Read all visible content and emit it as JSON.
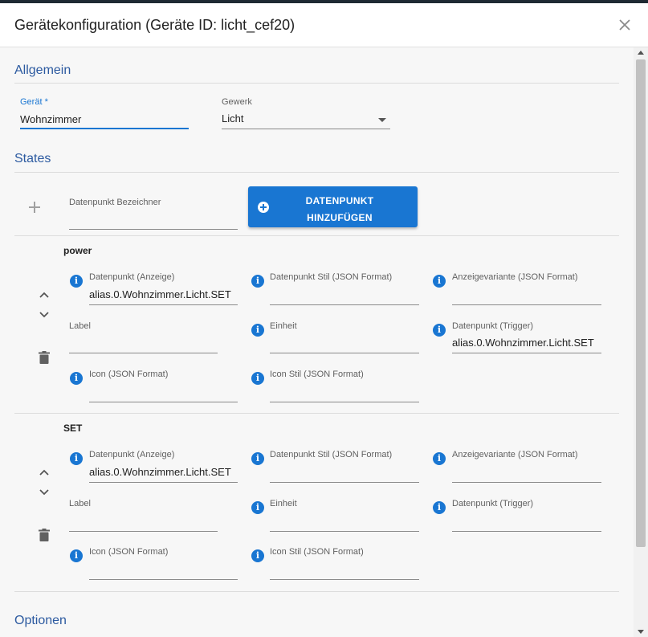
{
  "dialog": {
    "title": "Gerätekonfiguration (Geräte ID: licht_cef20)"
  },
  "sections": {
    "general": "Allgemein",
    "states": "States",
    "options": "Optionen"
  },
  "general": {
    "device_label": "Gerät *",
    "device_value": "Wohnzimmer",
    "trade_label": "Gewerk",
    "trade_value": "Licht"
  },
  "add_datapoint": {
    "label": "Datenpunkt Bezeichner",
    "value": "",
    "button_line1": "DATENPUNKT",
    "button_line2": "HINZUFÜGEN"
  },
  "states": [
    {
      "name": "power",
      "fields": {
        "dp_display_label": "Datenpunkt (Anzeige)",
        "dp_display_value": "alias.0.Wohnzimmer.Licht.SET",
        "dp_style_label": "Datenpunkt Stil (JSON Format)",
        "dp_style_value": "",
        "variant_label": "Anzeigevariante (JSON Format)",
        "variant_value": "",
        "label_label": "Label",
        "label_value": "",
        "unit_label": "Einheit",
        "unit_value": "",
        "trigger_label": "Datenpunkt (Trigger)",
        "trigger_value": "alias.0.Wohnzimmer.Licht.SET",
        "icon_label": "Icon (JSON Format)",
        "icon_value": "",
        "icon_style_label": "Icon Stil (JSON Format)",
        "icon_style_value": ""
      }
    },
    {
      "name": "SET",
      "fields": {
        "dp_display_label": "Datenpunkt (Anzeige)",
        "dp_display_value": "alias.0.Wohnzimmer.Licht.SET",
        "dp_style_label": "Datenpunkt Stil (JSON Format)",
        "dp_style_value": "",
        "variant_label": "Anzeigevariante (JSON Format)",
        "variant_value": "",
        "label_label": "Label",
        "label_value": "",
        "unit_label": "Einheit",
        "unit_value": "",
        "trigger_label": "Datenpunkt (Trigger)",
        "trigger_value": "",
        "icon_label": "Icon (JSON Format)",
        "icon_value": "",
        "icon_style_label": "Icon Stil (JSON Format)",
        "icon_style_value": ""
      }
    }
  ],
  "icons": {
    "info_glyph": "i",
    "close": "close-icon",
    "add": "plus-icon",
    "up": "chevron-up-icon",
    "down": "chevron-down-icon",
    "delete": "trash-icon"
  },
  "colors": {
    "primary": "#1976d2",
    "section_title": "#2c5aa0"
  }
}
